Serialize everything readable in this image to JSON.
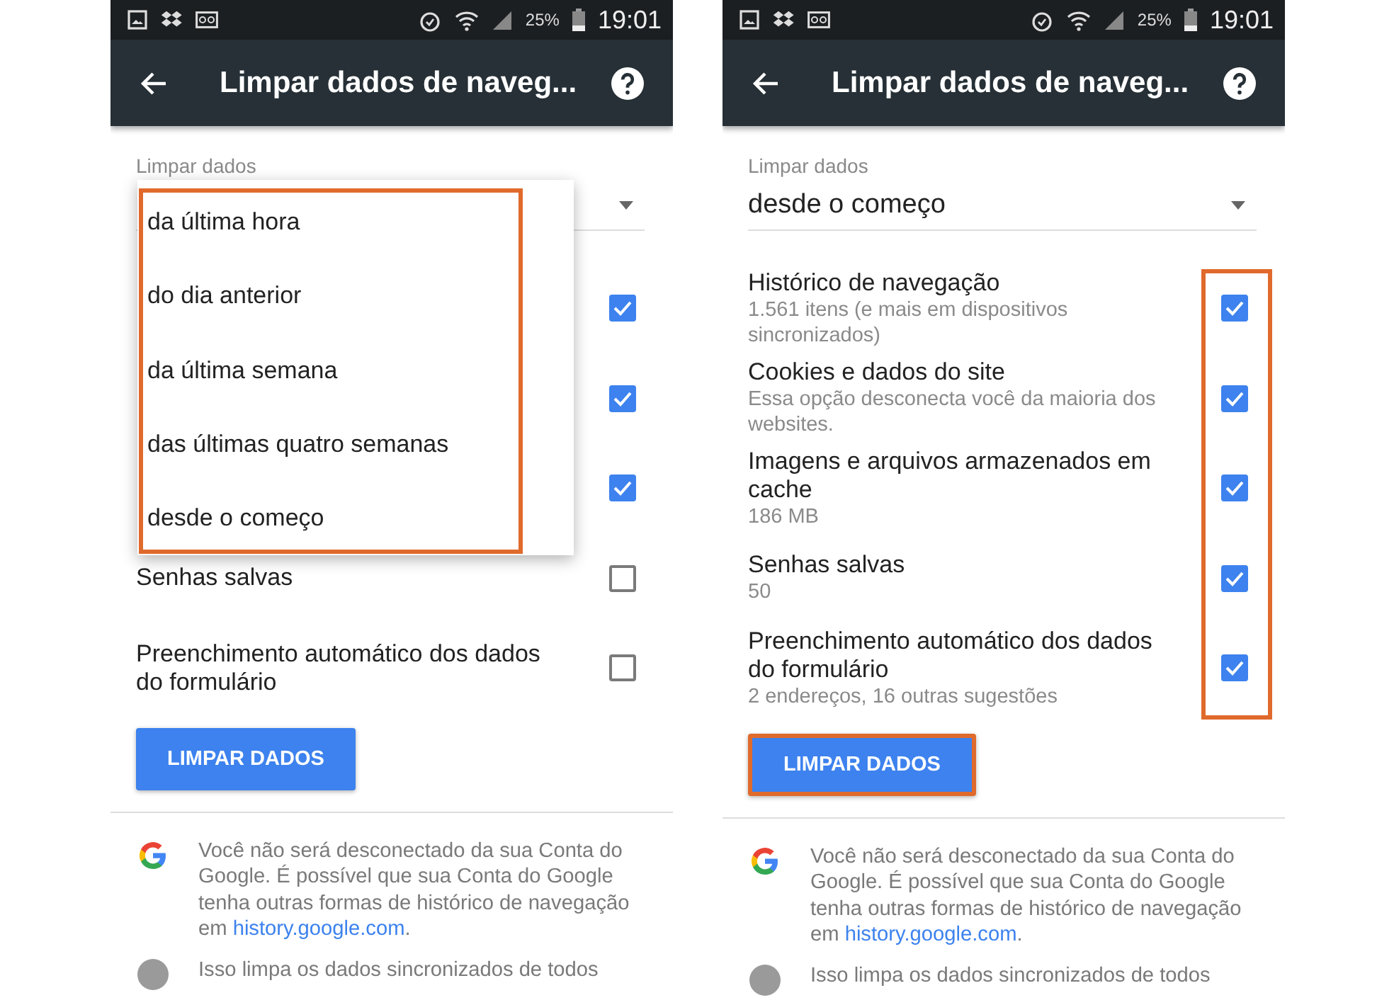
{
  "panels": [
    {
      "status_bar": {
        "battery": "25%",
        "time": "19:01"
      },
      "toolbar": {
        "title": "Limpar dados de naveg..."
      },
      "period": {
        "label": "Limpar dados"
      },
      "menu": {
        "highlighted": true,
        "items": [
          "da última hora",
          "do dia anterior",
          "da última semana",
          "das últimas quatro semanas",
          "desde o começo"
        ]
      },
      "options_highlighted": false,
      "options": [
        {
          "checked": true
        },
        {
          "checked": true
        },
        {
          "checked": true
        },
        {
          "title": "Senhas salvas",
          "checked": false
        },
        {
          "title": "Preenchimento automático dos dados do formulário",
          "checked": false
        }
      ],
      "button": {
        "label": "LIMPAR DADOS",
        "highlighted": false
      },
      "notes": [
        {
          "kind": "google",
          "text": "Você não será desconectado da sua Conta do Google. É possível que sua Conta do Google tenha outras formas de histórico de navegação em ",
          "link": "history.google.com",
          "end": "."
        },
        {
          "kind": "info",
          "text": "Isso limpa os dados sincronizados de todos"
        }
      ]
    },
    {
      "status_bar": {
        "battery": "25%",
        "time": "19:01"
      },
      "toolbar": {
        "title": "Limpar dados de naveg..."
      },
      "period": {
        "label": "Limpar dados",
        "value": "desde o começo"
      },
      "options_highlighted": true,
      "options": [
        {
          "title": "Histórico de navegação",
          "subtitle": "1.561 itens (e mais em dispositivos sincronizados)",
          "checked": true
        },
        {
          "title": "Cookies e dados do site",
          "subtitle": "Essa opção desconecta você da maioria dos websites.",
          "checked": true
        },
        {
          "title": "Imagens e arquivos armazenados em cache",
          "subtitle": "186 MB",
          "checked": true
        },
        {
          "title": "Senhas salvas",
          "subtitle": "50",
          "checked": true
        },
        {
          "title": "Preenchimento automático dos dados do formulário",
          "subtitle": "2 endereços, 16 outras sugestões",
          "checked": true
        }
      ],
      "button": {
        "label": "LIMPAR DADOS",
        "highlighted": true
      },
      "notes": [
        {
          "kind": "google",
          "text": "Você não será desconectado da sua Conta do Google. É possível que sua Conta do Google tenha outras formas de histórico de navegação em ",
          "link": "history.google.com",
          "end": "."
        },
        {
          "kind": "info",
          "text": "Isso limpa os dados sincronizados de todos"
        }
      ]
    }
  ]
}
